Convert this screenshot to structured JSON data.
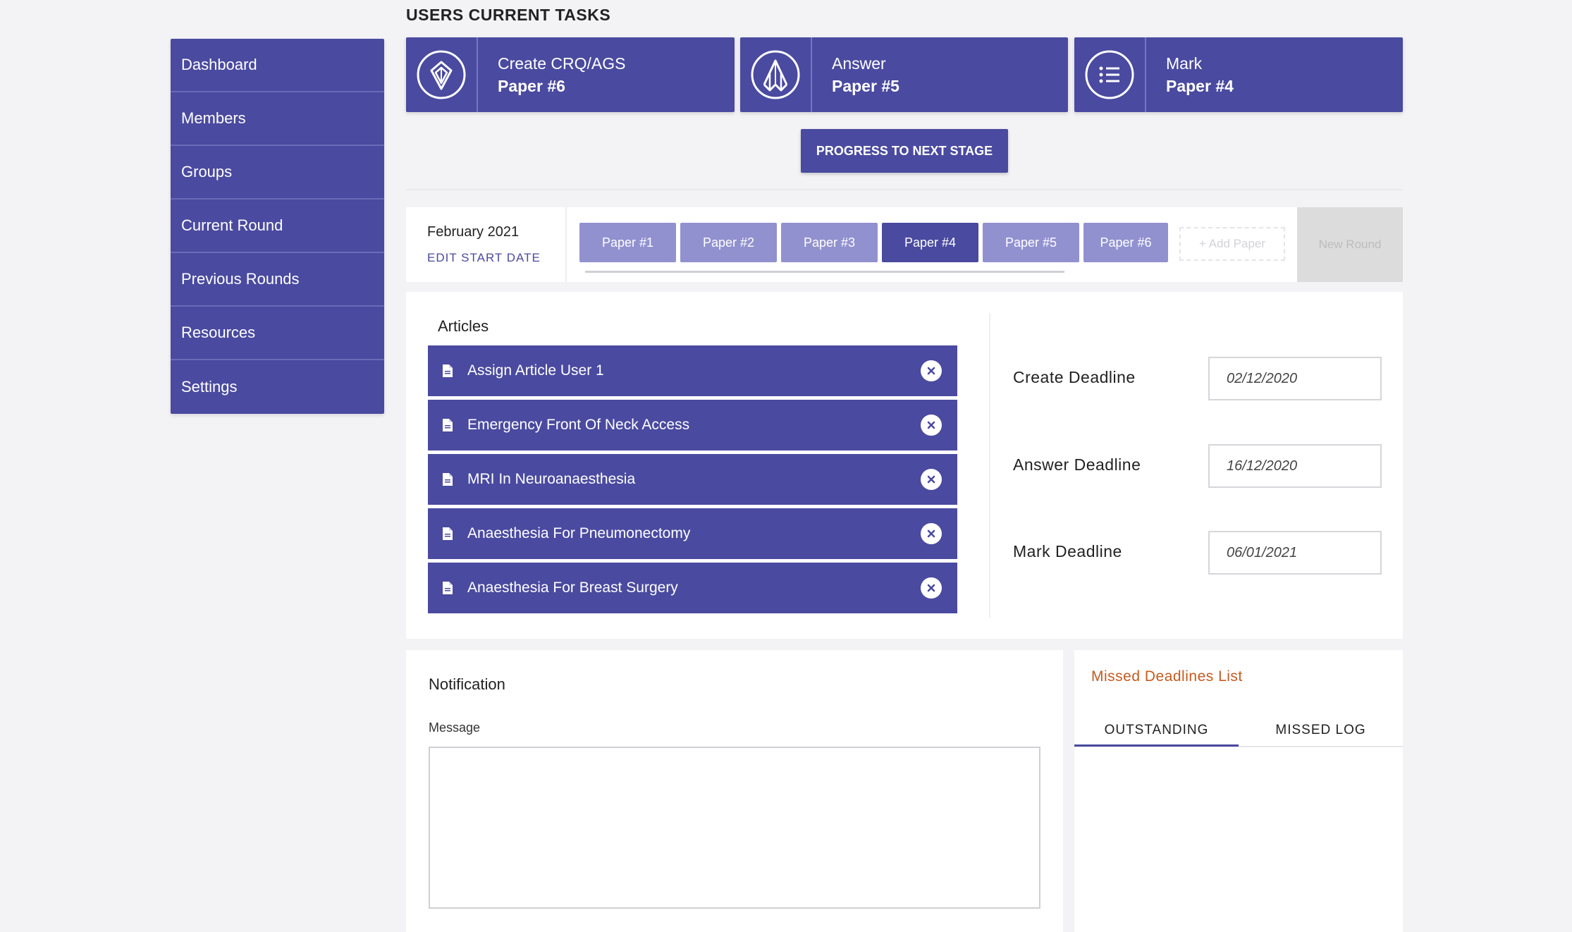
{
  "sidebar": {
    "items": [
      {
        "label": "Dashboard"
      },
      {
        "label": "Members"
      },
      {
        "label": "Groups"
      },
      {
        "label": "Current Round"
      },
      {
        "label": "Previous Rounds"
      },
      {
        "label": "Resources"
      },
      {
        "label": "Settings"
      }
    ]
  },
  "tasks": {
    "heading": "USERS CURRENT TASKS",
    "cards": [
      {
        "action": "Create CRQ/AGS",
        "paper": "Paper #6",
        "icon": "pen-nib-icon"
      },
      {
        "action": "Answer",
        "paper": "Paper #5",
        "icon": "pencil-tip-icon"
      },
      {
        "action": "Mark",
        "paper": "Paper #4",
        "icon": "list-icon"
      }
    ],
    "progress_label": "PROGRESS TO NEXT STAGE"
  },
  "round": {
    "start_date": "February 2021",
    "edit_label": "EDIT START DATE",
    "papers": [
      {
        "label": "Paper #1"
      },
      {
        "label": "Paper #2"
      },
      {
        "label": "Paper #3"
      },
      {
        "label": "Paper #4"
      },
      {
        "label": "Paper #5"
      },
      {
        "label": "Paper #6"
      }
    ],
    "active_paper": "Paper #4",
    "add_paper_label": "+ Add Paper",
    "new_round_label": "New Round"
  },
  "articles": {
    "title": "Articles",
    "items": [
      {
        "label": "Assign Article User 1"
      },
      {
        "label": "Emergency Front Of Neck Access"
      },
      {
        "label": "MRI In Neuroanaesthesia"
      },
      {
        "label": "Anaesthesia For Pneumonectomy"
      },
      {
        "label": "Anaesthesia For Breast Surgery"
      }
    ]
  },
  "deadlines": {
    "create": {
      "label": "Create Deadline",
      "value": "02/12/2020"
    },
    "answer": {
      "label": "Answer Deadline",
      "value": "16/12/2020"
    },
    "mark": {
      "label": "Mark Deadline",
      "value": "06/01/2021"
    }
  },
  "notification": {
    "title": "Notification",
    "message_label": "Message",
    "message_value": ""
  },
  "missed": {
    "title": "Missed Deadlines List",
    "tabs": [
      {
        "label": "OUTSTANDING"
      },
      {
        "label": "MISSED LOG"
      }
    ],
    "active_tab": "OUTSTANDING"
  },
  "colors": {
    "accent": "#4a4aa0",
    "tab_inactive": "#9191d0",
    "missed_title": "#c65a1e"
  }
}
